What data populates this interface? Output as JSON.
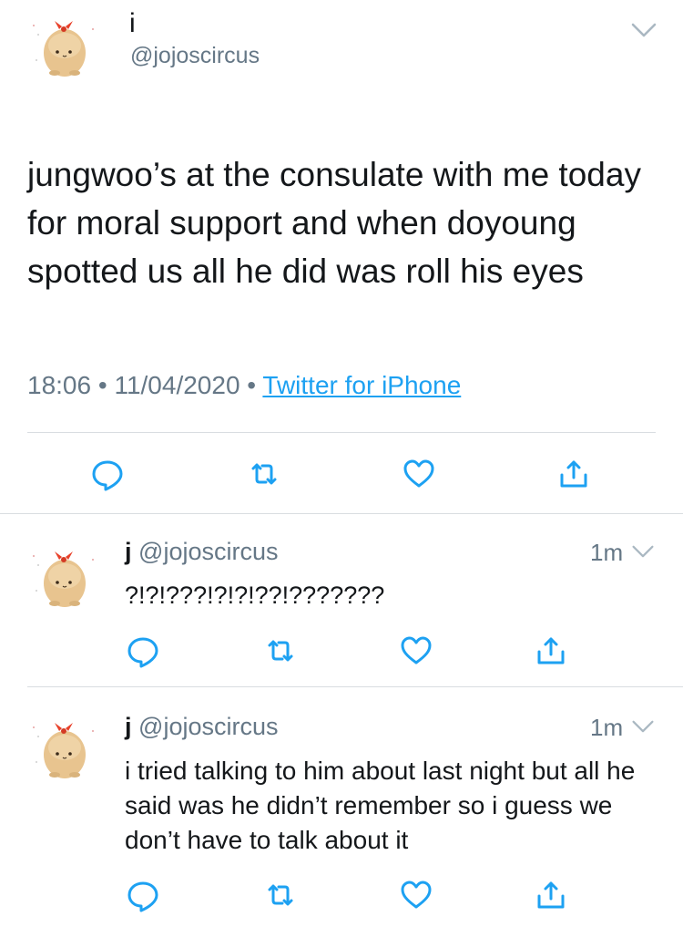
{
  "main_tweet": {
    "display_name": "i",
    "handle": "@jojoscircus",
    "text": "jungwoo’s at the consulate with me today for moral support and when doyoung spotted us all he did was roll his eyes",
    "time": "18:06",
    "date": "11/04/2020",
    "separator": "•",
    "source": "Twitter for iPhone"
  },
  "replies": [
    {
      "display_name": "j",
      "handle": "@jojoscircus",
      "age": "1m",
      "text": "?!?!???!?!?!??!???????"
    },
    {
      "display_name": "j",
      "handle": "@jojoscircus",
      "age": "1m",
      "text": "i tried talking to him about last night but all he said was he didn’t remember so i guess we don’t have to talk about it"
    }
  ],
  "actions": [
    "reply-icon",
    "retweet-icon",
    "like-icon",
    "share-icon"
  ],
  "colors": {
    "link": "#1da1f2",
    "muted": "#657786",
    "icon": "#1da1f2",
    "avatar_body": "#e8c48f",
    "avatar_bow": "#e8412a"
  }
}
